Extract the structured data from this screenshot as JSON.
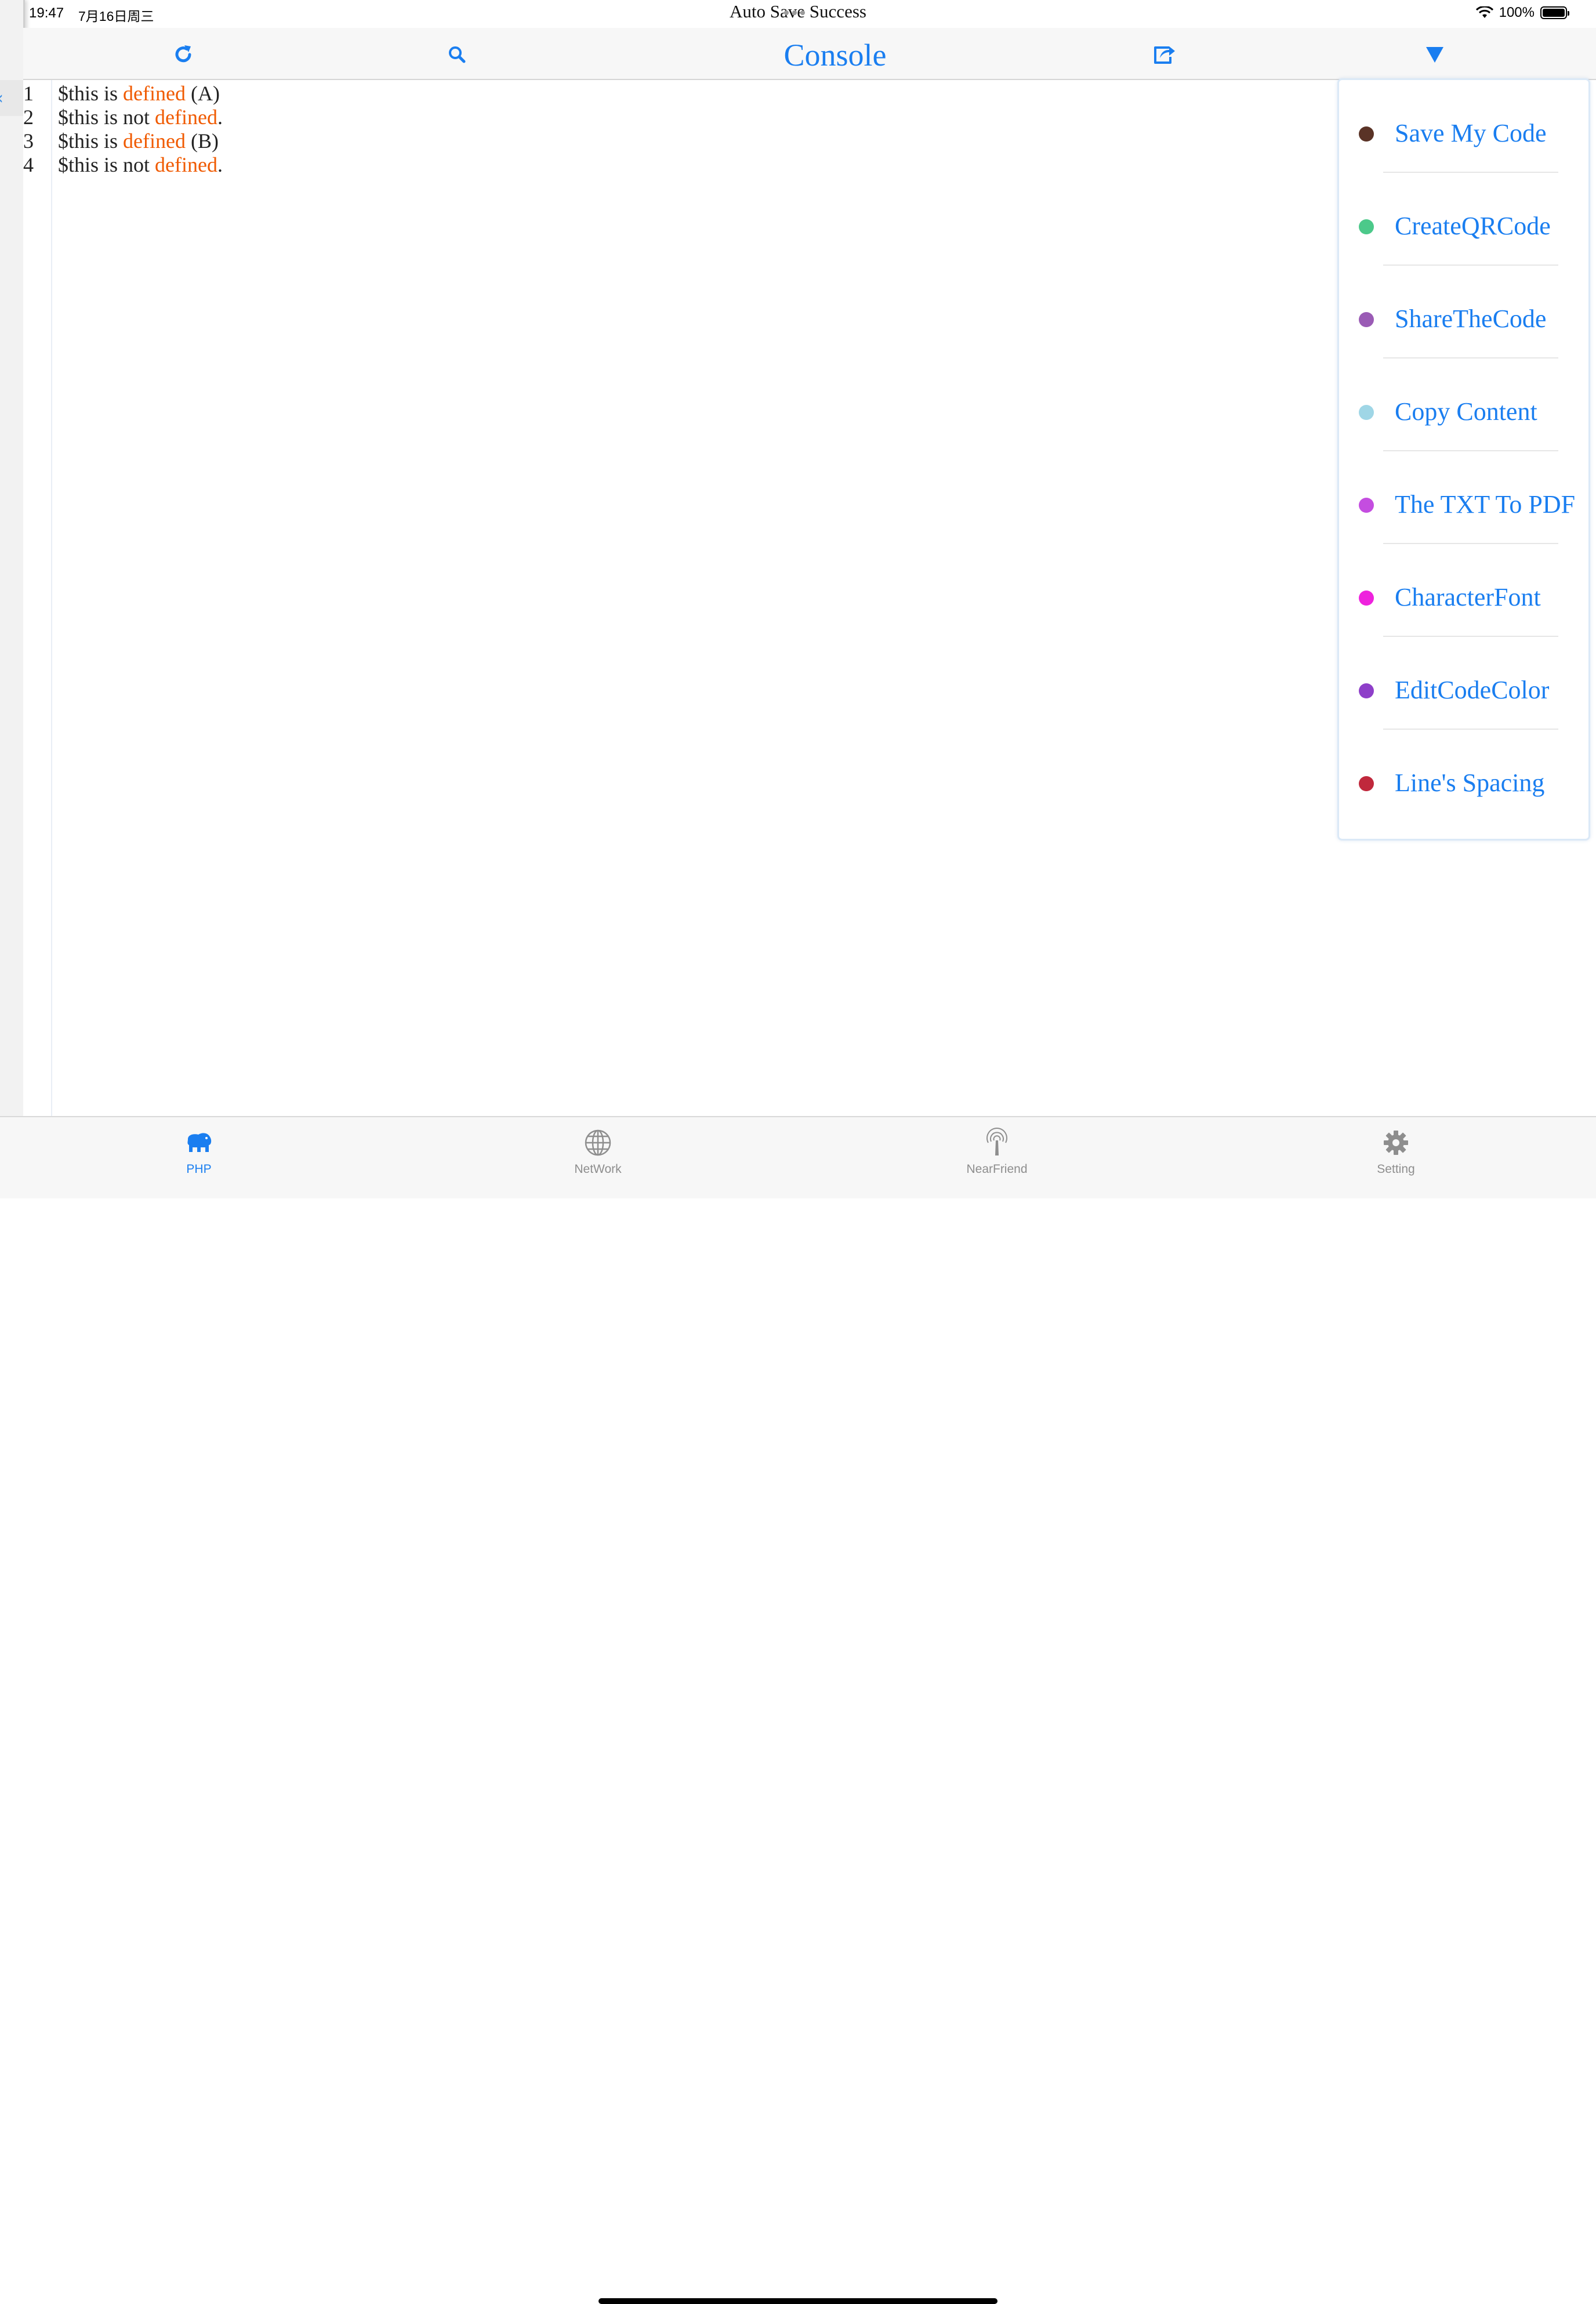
{
  "status_bar": {
    "time": "19:47",
    "date": "7月16日周三",
    "message": "Auto Save Success",
    "battery": "100%"
  },
  "toolbar": {
    "title": "Console",
    "icons": [
      "refresh-icon",
      "search-icon",
      "share-icon",
      "dropdown-triangle-icon"
    ]
  },
  "editor": {
    "lines": [
      {
        "num": "1",
        "pre": "$this is ",
        "kw": "defined",
        "post": " (A)"
      },
      {
        "num": "2",
        "pre": "$this is not ",
        "kw": "defined",
        "post": "."
      },
      {
        "num": "3",
        "pre": "$this is ",
        "kw": "defined",
        "post": " (B)"
      },
      {
        "num": "4",
        "pre": "$this is not ",
        "kw": "defined",
        "post": "."
      }
    ],
    "keyword_color": "#f05a00"
  },
  "menu": {
    "items": [
      {
        "label": "Save My Code",
        "color": "#5a3326"
      },
      {
        "label": "CreateQRCode",
        "color": "#4cc98a"
      },
      {
        "label": "ShareTheCode",
        "color": "#9a5bb5"
      },
      {
        "label": "Copy Content",
        "color": "#9fd6e6"
      },
      {
        "label": "The TXT To PDF",
        "color": "#c44de0"
      },
      {
        "label": "CharacterFont",
        "color": "#ee22dd"
      },
      {
        "label": "EditCodeColor",
        "color": "#8e3fc9"
      },
      {
        "label": "Line's Spacing",
        "color": "#c0283c"
      }
    ],
    "accent": "#1a7ef0"
  },
  "tabbar": {
    "tabs": [
      {
        "label": "PHP",
        "icon": "elephant-icon",
        "active": true
      },
      {
        "label": "NetWork",
        "icon": "globe-icon",
        "active": false
      },
      {
        "label": "NearFriend",
        "icon": "antenna-icon",
        "active": false
      },
      {
        "label": "Setting",
        "icon": "gear-icon",
        "active": false
      }
    ],
    "active_color": "#1a7ef0",
    "inactive_color": "#8e8e8e"
  }
}
